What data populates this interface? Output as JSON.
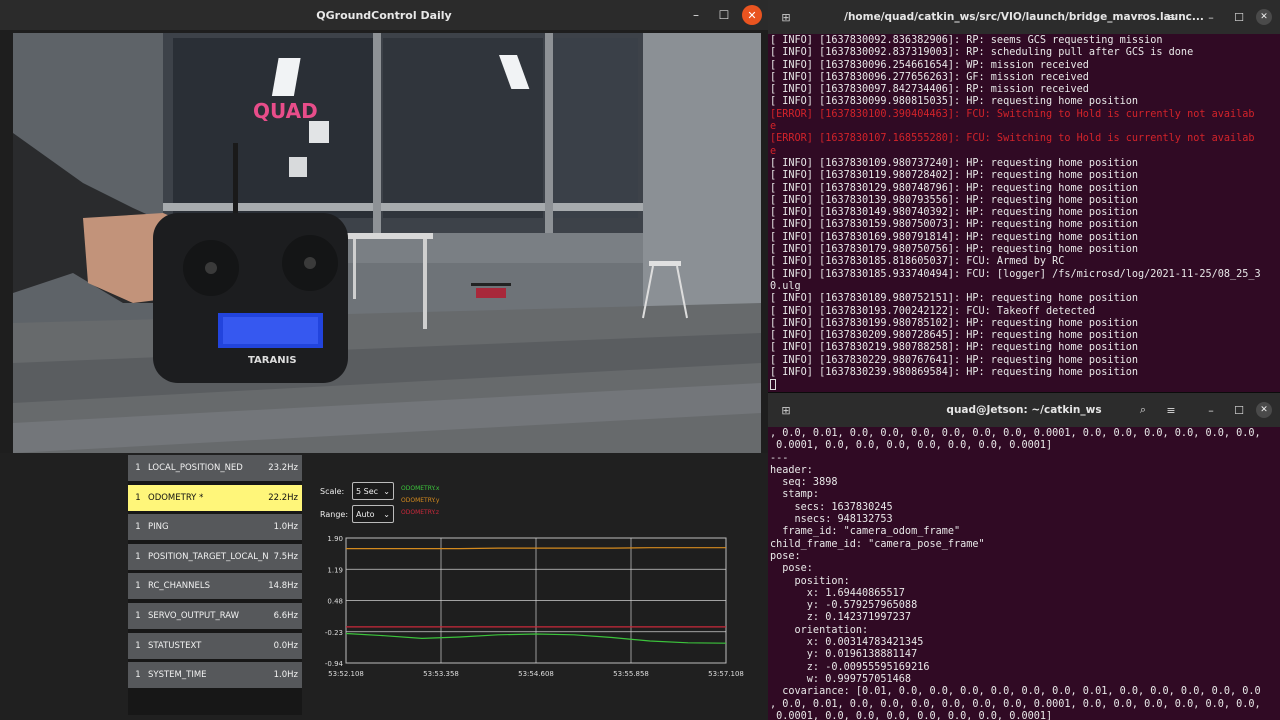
{
  "qgc": {
    "window_title": "QGroundControl Daily",
    "buttons": {
      "minimize": "–",
      "maximize": "☐",
      "close": "✕"
    },
    "video_text": {
      "logo": "QUAD",
      "radio_brand": "TARANIS"
    },
    "messages": [
      {
        "sys": "1",
        "name": "LOCAL_POSITION_NED",
        "rate": "23.2Hz",
        "selected": false
      },
      {
        "sys": "1",
        "name": "ODOMETRY *",
        "rate": "22.2Hz",
        "selected": true
      },
      {
        "sys": "1",
        "name": "PING",
        "rate": "1.0Hz",
        "selected": false
      },
      {
        "sys": "1",
        "name": "POSITION_TARGET_LOCAL_NED",
        "rate": "7.5Hz",
        "selected": false
      },
      {
        "sys": "1",
        "name": "RC_CHANNELS",
        "rate": "14.8Hz",
        "selected": false
      },
      {
        "sys": "1",
        "name": "SERVO_OUTPUT_RAW",
        "rate": "6.6Hz",
        "selected": false
      },
      {
        "sys": "1",
        "name": "STATUSTEXT",
        "rate": "0.0Hz",
        "selected": false
      },
      {
        "sys": "1",
        "name": "SYSTEM_TIME",
        "rate": "1.0Hz",
        "selected": false
      }
    ],
    "plot_controls": {
      "scale_label": "Scale:",
      "scale_value": "5 Sec",
      "range_label": "Range:",
      "range_value": "Auto"
    }
  },
  "chart_data": {
    "type": "line",
    "title": "",
    "xlabel": "",
    "ylabel": "",
    "x_ticks": [
      "53:52.108",
      "53:53.358",
      "53:54.608",
      "53:55.858",
      "53:57.108"
    ],
    "y_ticks": [
      "1.90",
      "1.19",
      "0.48",
      "-0.23",
      "-0.94"
    ],
    "ylim": [
      -0.94,
      1.9
    ],
    "grid": true,
    "legend_position": "top-left",
    "x": [
      0,
      0.5,
      1.0,
      1.5,
      2.0,
      2.5,
      3.0,
      3.5,
      4.0,
      4.5,
      5.0
    ],
    "series": [
      {
        "name": "ODOMETRY.x",
        "color": "#3cc43c",
        "values": [
          -0.27,
          -0.32,
          -0.38,
          -0.35,
          -0.3,
          -0.28,
          -0.3,
          -0.36,
          -0.44,
          -0.48,
          -0.49
        ]
      },
      {
        "name": "ODOMETRY.y",
        "color": "#d48a1e",
        "values": [
          1.66,
          1.66,
          1.66,
          1.66,
          1.67,
          1.67,
          1.67,
          1.67,
          1.68,
          1.68,
          1.68
        ]
      },
      {
        "name": "ODOMETRY.z",
        "color": "#c9283a",
        "values": [
          -0.12,
          -0.12,
          -0.12,
          -0.12,
          -0.12,
          -0.12,
          -0.12,
          -0.12,
          -0.12,
          -0.12,
          -0.12
        ]
      }
    ]
  },
  "term1": {
    "title": "/home/quad/catkin_ws/src/VIO/launch/bridge_mavros.launc...",
    "lines": [
      {
        "t": "[ INFO] [1637830092.836382906]: RP: seems GCS requesting mission",
        "err": false
      },
      {
        "t": "[ INFO] [1637830092.837319003]: RP: scheduling pull after GCS is done",
        "err": false
      },
      {
        "t": "[ INFO] [1637830096.254661654]: WP: mission received",
        "err": false
      },
      {
        "t": "[ INFO] [1637830096.277656263]: GF: mission received",
        "err": false
      },
      {
        "t": "[ INFO] [1637830097.842734406]: RP: mission received",
        "err": false
      },
      {
        "t": "[ INFO] [1637830099.980815035]: HP: requesting home position",
        "err": false
      },
      {
        "t": "[ERROR] [1637830100.390404463]: FCU: Switching to Hold is currently not availab",
        "err": true
      },
      {
        "t": "e",
        "err": true
      },
      {
        "t": "[ERROR] [1637830107.168555280]: FCU: Switching to Hold is currently not availab",
        "err": true
      },
      {
        "t": "e",
        "err": true
      },
      {
        "t": "[ INFO] [1637830109.980737240]: HP: requesting home position",
        "err": false
      },
      {
        "t": "[ INFO] [1637830119.980728402]: HP: requesting home position",
        "err": false
      },
      {
        "t": "[ INFO] [1637830129.980748796]: HP: requesting home position",
        "err": false
      },
      {
        "t": "[ INFO] [1637830139.980793556]: HP: requesting home position",
        "err": false
      },
      {
        "t": "[ INFO] [1637830149.980740392]: HP: requesting home position",
        "err": false
      },
      {
        "t": "[ INFO] [1637830159.980750073]: HP: requesting home position",
        "err": false
      },
      {
        "t": "[ INFO] [1637830169.980791814]: HP: requesting home position",
        "err": false
      },
      {
        "t": "[ INFO] [1637830179.980750756]: HP: requesting home position",
        "err": false
      },
      {
        "t": "[ INFO] [1637830185.818605037]: FCU: Armed by RC",
        "err": false
      },
      {
        "t": "[ INFO] [1637830185.933740494]: FCU: [logger] /fs/microsd/log/2021-11-25/08_25_3",
        "err": false
      },
      {
        "t": "0.ulg",
        "err": false
      },
      {
        "t": "[ INFO] [1637830189.980752151]: HP: requesting home position",
        "err": false
      },
      {
        "t": "[ INFO] [1637830193.700242122]: FCU: Takeoff detected",
        "err": false
      },
      {
        "t": "[ INFO] [1637830199.980785102]: HP: requesting home position",
        "err": false
      },
      {
        "t": "[ INFO] [1637830209.980728645]: HP: requesting home position",
        "err": false
      },
      {
        "t": "[ INFO] [1637830219.980788258]: HP: requesting home position",
        "err": false
      },
      {
        "t": "[ INFO] [1637830229.980767641]: HP: requesting home position",
        "err": false
      },
      {
        "t": "[ INFO] [1637830239.980869584]: HP: requesting home position",
        "err": false
      }
    ]
  },
  "term2": {
    "title": "quad@Jetson: ~/catkin_ws",
    "lines": [
      ", 0.0, 0.01, 0.0, 0.0, 0.0, 0.0, 0.0, 0.0, 0.0001, 0.0, 0.0, 0.0, 0.0, 0.0, 0.0,",
      " 0.0001, 0.0, 0.0, 0.0, 0.0, 0.0, 0.0, 0.0001]",
      "---",
      "header:",
      "  seq: 3898",
      "  stamp:",
      "    secs: 1637830245",
      "    nsecs: 948132753",
      "  frame_id: \"camera_odom_frame\"",
      "child_frame_id: \"camera_pose_frame\"",
      "pose:",
      "  pose:",
      "    position:",
      "      x: 1.69440865517",
      "      y: -0.579257965088",
      "      z: 0.142371997237",
      "    orientation:",
      "      x: 0.00314783421345",
      "      y: 0.0196138881147",
      "      z: -0.00955595169216",
      "      w: 0.999757051468",
      "  covariance: [0.01, 0.0, 0.0, 0.0, 0.0, 0.0, 0.0, 0.01, 0.0, 0.0, 0.0, 0.0, 0.0",
      ", 0.0, 0.01, 0.0, 0.0, 0.0, 0.0, 0.0, 0.0, 0.0001, 0.0, 0.0, 0.0, 0.0, 0.0, 0.0,",
      " 0.0001, 0.0, 0.0, 0.0, 0.0, 0.0, 0.0, 0.0001]"
    ]
  },
  "term_buttons": {
    "new_tab": "⊞",
    "search": "⌕",
    "menu": "≡",
    "minimize": "–",
    "maximize": "☐",
    "close": "✕"
  }
}
